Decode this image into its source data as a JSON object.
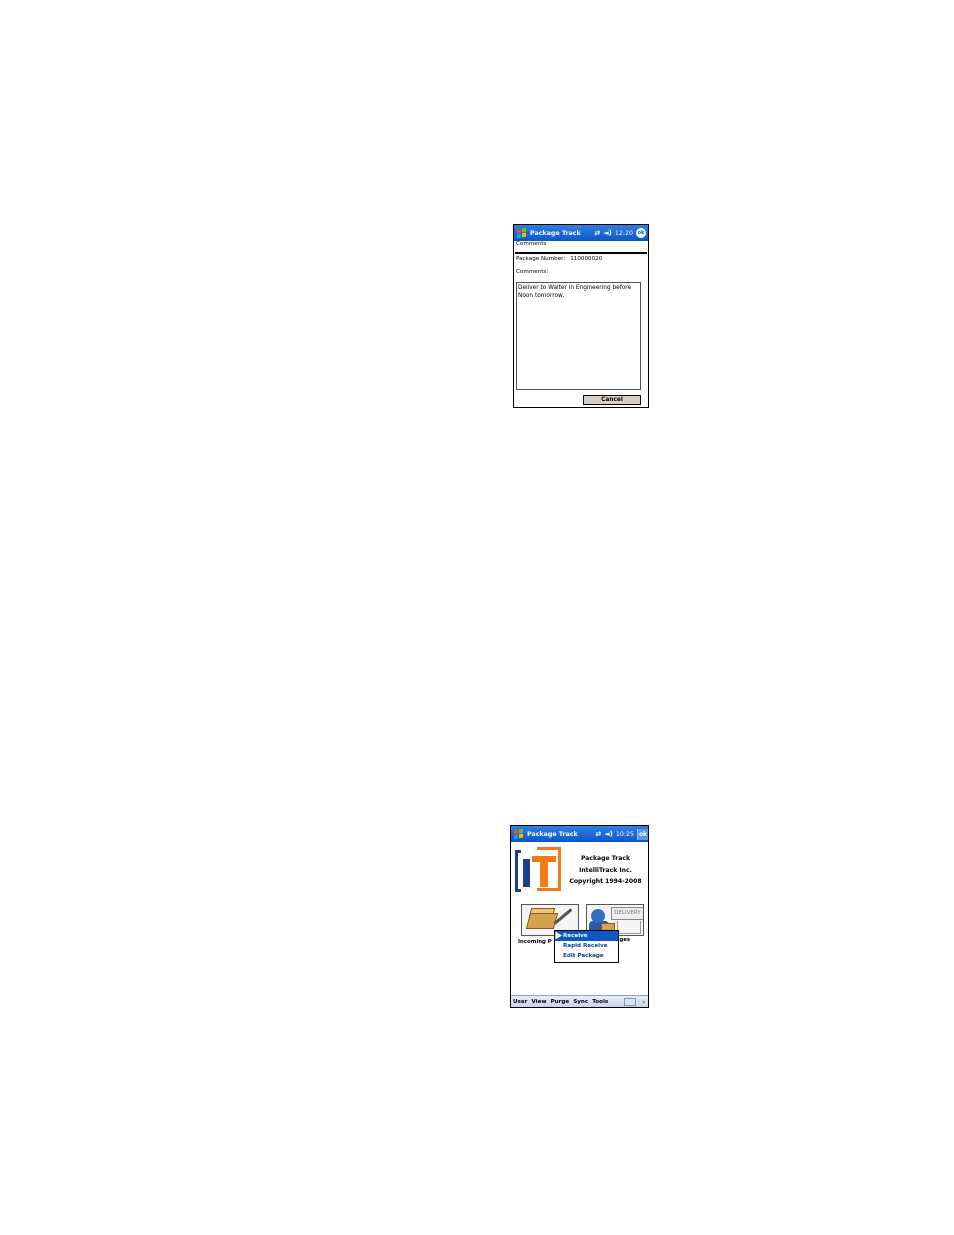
{
  "screen1": {
    "titlebar": {
      "app_title": "Package Track",
      "time": "12:20",
      "sync_icon": "sync-arrows-icon",
      "volume_icon": "speaker-icon",
      "ok_label": "ok"
    },
    "header": "Comments",
    "package_number_label": "Package Number:",
    "package_number_value": "110000020",
    "comments_label": "Comments:",
    "comments_value": "Deliver to Walter in Engineering before Noon tomorrow.",
    "cancel_label": "Cancel"
  },
  "screen2": {
    "titlebar": {
      "app_title": "Package Track",
      "time": "10:25",
      "ok_label": "ok"
    },
    "about": {
      "line1": "Package Track",
      "line2": "IntelliTrack Inc.",
      "line3": "Copyright 1994-2008"
    },
    "tiles": {
      "incoming_label": "Incoming P",
      "outgoing_label": "ckages",
      "delivery_sign": "DELIVERY"
    },
    "context_menu": {
      "items": [
        "Receive",
        "Rapid Receive",
        "Edit Package"
      ],
      "selected": "Receive"
    },
    "menubar": {
      "items": [
        "User",
        "View",
        "Purge",
        "Sync",
        "Tools"
      ]
    }
  }
}
